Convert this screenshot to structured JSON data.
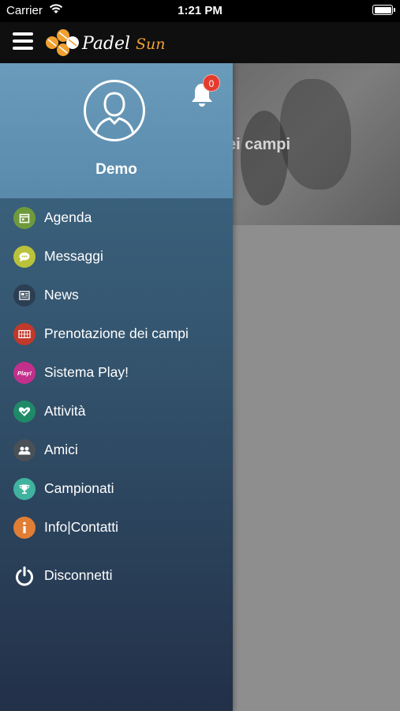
{
  "status_bar": {
    "carrier": "Carrier",
    "time": "1:21 PM"
  },
  "navbar": {
    "logo_text": "Padel Sun"
  },
  "background": {
    "hero_title": "ei campi"
  },
  "profile": {
    "username": "Demo",
    "notifications_count": "0"
  },
  "menu": [
    {
      "label": "Agenda",
      "icon": "calendar-icon",
      "color": "#6f9a3c"
    },
    {
      "label": "Messaggi",
      "icon": "chat-bubble-icon",
      "color": "#b9c23a"
    },
    {
      "label": "News",
      "icon": "newspaper-icon",
      "color": "#2c3e52"
    },
    {
      "label": "Prenotazione dei campi",
      "icon": "court-icon",
      "color": "#c0392b"
    },
    {
      "label": "Sistema Play!",
      "icon": "play-badge-icon",
      "color": "#c2308c"
    },
    {
      "label": "Attività",
      "icon": "heart-check-icon",
      "color": "#1f8a68"
    },
    {
      "label": "Amici",
      "icon": "friends-icon",
      "color": "#4a5156"
    },
    {
      "label": "Campionati",
      "icon": "trophy-icon",
      "color": "#3fb3a0"
    },
    {
      "label": "Info|Contatti",
      "icon": "info-icon",
      "color": "#e07e36"
    }
  ],
  "logout": {
    "label": "Disconnetti",
    "icon": "power-icon"
  },
  "colors": {
    "drawer_top": "#3e6a86",
    "drawer_bottom": "#223048",
    "profile_bg": "#6a9bbb",
    "badge": "#e43b2e",
    "logo_orange": "#f0a030"
  }
}
